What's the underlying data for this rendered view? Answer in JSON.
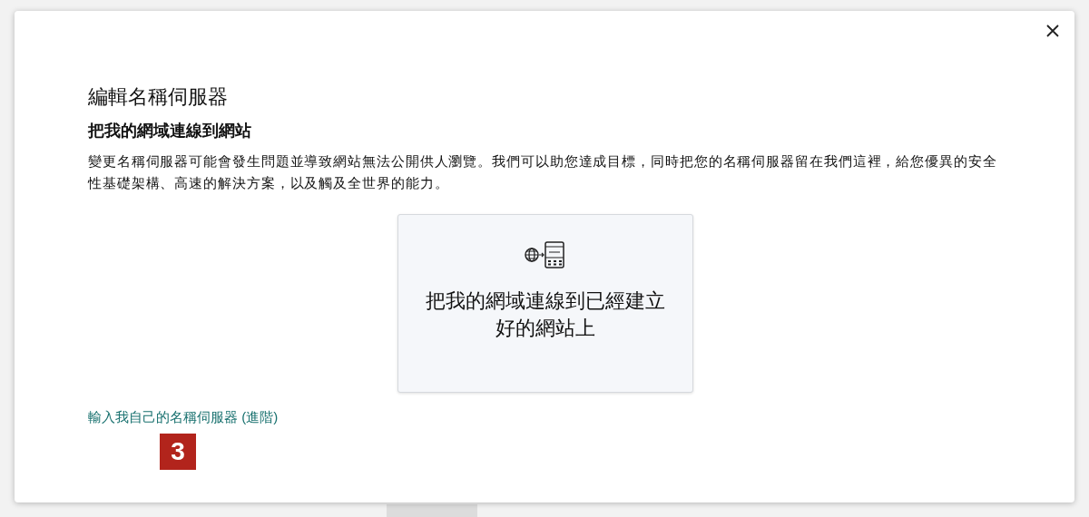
{
  "dialog": {
    "title": "編輯名稱伺服器",
    "subtitle": "把我的網域連線到網站",
    "description": "變更名稱伺服器可能會發生問題並導致網站無法公開供人瀏覽。我們可以助您達成目標，同時把您的名稱伺服器留在我們這裡，給您優異的安全性基礎架構、高速的解決方案，以及觸及全世界的能力。",
    "option": {
      "label": "把我的網域連線到已經建立好的網站上"
    },
    "advanced_link": "輸入我自己的名稱伺服器 (進階)",
    "step_badge": "3"
  }
}
